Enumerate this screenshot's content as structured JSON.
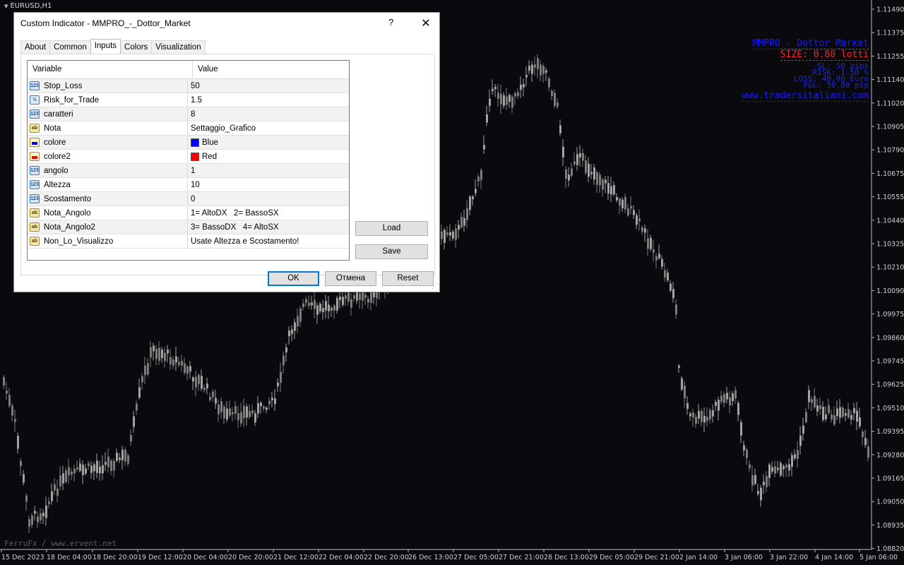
{
  "chart": {
    "symbol": "EURUSD,H1",
    "watermark": "FerruFx / www.ervent.net",
    "price_labels": [
      "1.11490",
      "1.11375",
      "1.11255",
      "1.11140",
      "1.11020",
      "1.10905",
      "1.10790",
      "1.10675",
      "1.10555",
      "1.10440",
      "1.10325",
      "1.10210",
      "1.10090",
      "1.09975",
      "1.09860",
      "1.09745",
      "1.09625",
      "1.09510",
      "1.09395",
      "1.09280",
      "1.09165",
      "1.09050",
      "1.08935",
      "1.08820"
    ],
    "time_labels": [
      "15 Dec 2023",
      "18 Dec 04:00",
      "18 Dec 20:00",
      "19 Dec 12:00",
      "20 Dec 04:00",
      "20 Dec 20:00",
      "21 Dec 12:00",
      "22 Dec 04:00",
      "22 Dec 20:00",
      "26 Dec 13:00",
      "27 Dec 05:00",
      "27 Dec 21:00",
      "28 Dec 13:00",
      "29 Dec 05:00",
      "29 Dec 21:00",
      "2 Jan 14:00",
      "3 Jan 06:00",
      "3 Jan 22:00",
      "4 Jan 14:00",
      "5 Jan 06:00"
    ],
    "colors": {
      "background": "#0a0a0e",
      "candle": "#9a9a9a",
      "axis_text": "#d0d0d0",
      "overlay_blue": "#1919ff",
      "overlay_red": "#ff2020"
    }
  },
  "overlay": {
    "title": "MMPRO - Dottor Market",
    "size": "SIZE: 0.80 lotti",
    "sl": "SL: 50 pips",
    "risk": "RISK: 1.50 %",
    "loss": "LOSS: 40.00 Euro",
    "pl": "P&L: 50.80 pip",
    "site": "www.tradersitaliani.com"
  },
  "dialog": {
    "title": "Custom Indicator - MMPRO_-_Dottor_Market",
    "help": "?",
    "close": "✕",
    "tabs": [
      "About",
      "Common",
      "Inputs",
      "Colors",
      "Visualization"
    ],
    "active_tab": "Inputs",
    "columns": {
      "variable": "Variable",
      "value": "Value"
    },
    "rows": [
      {
        "icon": "int-icon",
        "name": "Stop_Loss",
        "value": "50"
      },
      {
        "icon": "double-icon",
        "name": "Risk_for_Trade",
        "value": "1.5"
      },
      {
        "icon": "int-icon",
        "name": "caratteri",
        "value": "8"
      },
      {
        "icon": "string-icon",
        "name": "Nota",
        "value": "Settaggio_Grafico"
      },
      {
        "icon": "color-icon",
        "name": "colore",
        "value": "Blue",
        "swatch": "#0000ff"
      },
      {
        "icon": "color-icon",
        "name": "colore2",
        "value": "Red",
        "swatch": "#ff0000"
      },
      {
        "icon": "int-icon",
        "name": "angolo",
        "value": "1"
      },
      {
        "icon": "int-icon",
        "name": "Altezza",
        "value": "10"
      },
      {
        "icon": "int-icon",
        "name": "Scostamento",
        "value": "0"
      },
      {
        "icon": "string-icon",
        "name": "Nota_Angolo",
        "value": "1= AltoDX   2= BassoSX"
      },
      {
        "icon": "string-icon",
        "name": "Nota_Angolo2",
        "value": "3= BassoDX   4= AltoSX"
      },
      {
        "icon": "string-icon",
        "name": "Non_Lo_Visualizzo",
        "value": "Usate Altezza e Scostamento!"
      }
    ],
    "buttons": {
      "load": "Load",
      "save": "Save",
      "ok": "OK",
      "cancel": "Отмена",
      "reset": "Reset"
    }
  }
}
